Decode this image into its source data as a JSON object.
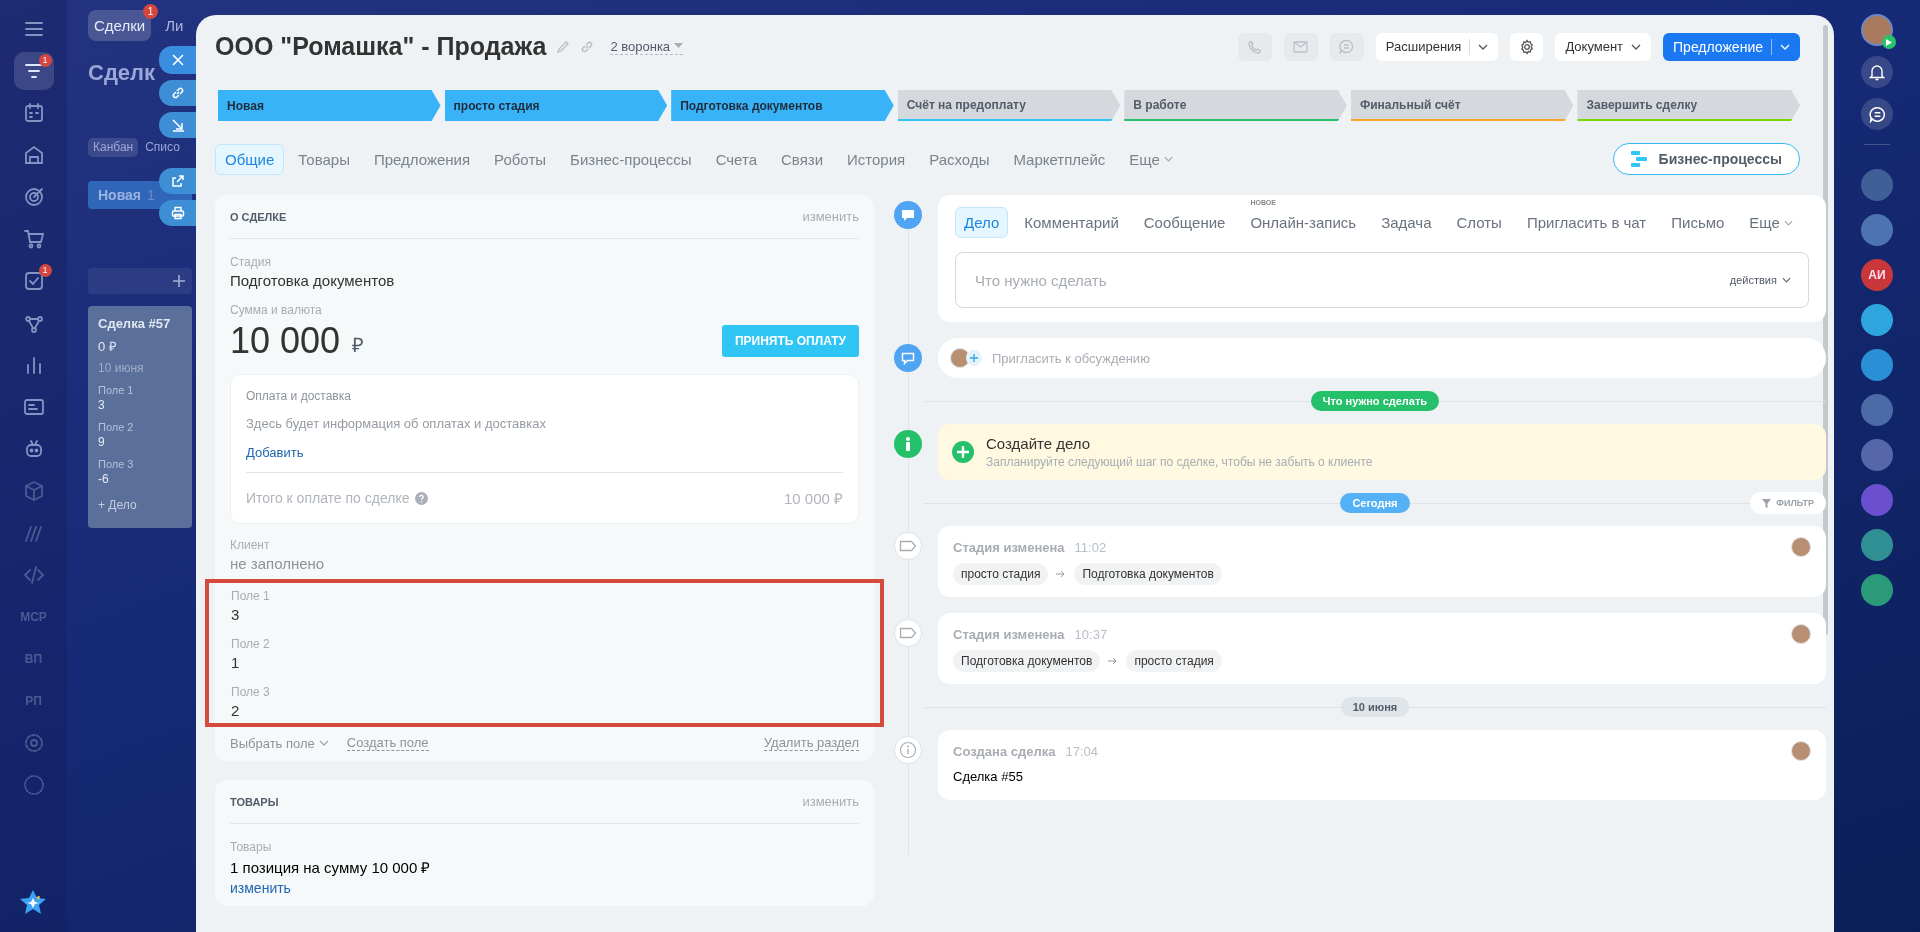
{
  "left_nav": [
    {
      "kind": "menu",
      "selected": false
    },
    {
      "kind": "funnel",
      "badge": "1",
      "selected": true
    },
    {
      "kind": "calendar",
      "selected": false
    },
    {
      "kind": "storage",
      "selected": false
    },
    {
      "kind": "target",
      "selected": false
    },
    {
      "kind": "cart",
      "selected": false
    },
    {
      "kind": "task",
      "badge": "1",
      "selected": false
    },
    {
      "kind": "flow",
      "selected": false
    },
    {
      "kind": "chart",
      "selected": false
    },
    {
      "kind": "card",
      "selected": false
    },
    {
      "kind": "robot",
      "selected": false
    },
    {
      "kind": "box",
      "selected": false
    },
    {
      "kind": "stripes",
      "selected": false
    },
    {
      "kind": "code",
      "selected": false
    },
    {
      "kind": "text",
      "label": "MCP",
      "selected": false
    },
    {
      "kind": "text",
      "label": "ВП",
      "selected": false
    },
    {
      "kind": "text",
      "label": "РП",
      "selected": false
    },
    {
      "kind": "gear",
      "selected": false
    },
    {
      "kind": "sphere",
      "selected": false
    }
  ],
  "background_page": {
    "tabs": [
      {
        "label": "Сделки",
        "badge": "1",
        "selected": true
      },
      {
        "label": "Ли",
        "selected": false
      }
    ],
    "title": "Сделк",
    "views": [
      {
        "label": "Канбан",
        "selected": true
      },
      {
        "label": "Списо",
        "selected": false
      }
    ],
    "column": {
      "name": "Новая",
      "count": "1"
    },
    "card": {
      "title": "Сделка #57",
      "amount": "0 ₽",
      "date": "10 июня",
      "fields": [
        {
          "label": "Поле 1",
          "value": "3"
        },
        {
          "label": "Поле 2",
          "value": "9"
        },
        {
          "label": "Поле 3",
          "value": "-6"
        }
      ],
      "add": "+ Дело"
    }
  },
  "window": {
    "title": "ООО \"Ромашка\" - Продажа",
    "funnel": "2 воронка",
    "actions": [
      {
        "kind": "extensions",
        "label": "Расширения"
      },
      {
        "kind": "document",
        "label": "Документ"
      },
      {
        "kind": "primary",
        "label": "Предложение"
      }
    ]
  },
  "stages": [
    {
      "label": "Новая",
      "reached": true,
      "color": "#39b3f7"
    },
    {
      "label": "просто стадия",
      "reached": true,
      "color": "#39b3f7"
    },
    {
      "label": "Подготовка документов",
      "reached": true,
      "color": "#39b3f7"
    },
    {
      "label": "Счёт на предоплату",
      "reached": false,
      "color": "#2fc6f6"
    },
    {
      "label": "В работе",
      "reached": false,
      "color": "#25c16a"
    },
    {
      "label": "Финальный счёт",
      "reached": false,
      "color": "#f5a623"
    },
    {
      "label": "Завершить сделку",
      "reached": false,
      "color": "#7bd500"
    }
  ],
  "tabs": [
    {
      "label": "Общие",
      "selected": true
    },
    {
      "label": "Товары",
      "selected": false
    },
    {
      "label": "Предложения",
      "selected": false
    },
    {
      "label": "Роботы",
      "selected": false
    },
    {
      "label": "Бизнес-процессы",
      "selected": false
    },
    {
      "label": "Счета",
      "selected": false
    },
    {
      "label": "Связи",
      "selected": false
    },
    {
      "label": "История",
      "selected": false
    },
    {
      "label": "Расходы",
      "selected": false
    },
    {
      "label": "Маркетплейс",
      "selected": false
    },
    {
      "label": "Еще",
      "selected": false
    }
  ],
  "bp_button": "Бизнес-процессы",
  "deal": {
    "heading": "О СДЕЛКЕ",
    "edit": "изменить",
    "stage_label": "Стадия",
    "stage": "Подготовка документов",
    "amount_label": "Сумма и валюта",
    "amount": "10 000",
    "currency": "₽",
    "pay_button": "ПРИНЯТЬ ОПЛАТУ",
    "payment": {
      "title": "Оплата и доставка",
      "info": "Здесь будет информация об оплатах и доставках",
      "add": "Добавить",
      "total_label": "Итого к оплате по сделке",
      "total": "10 000 ₽"
    },
    "client_label": "Клиент",
    "client": "не заполнено",
    "fields_highlighted": true,
    "fields": [
      {
        "label": "Поле 1",
        "value": "3"
      },
      {
        "label": "Поле 2",
        "value": "1"
      },
      {
        "label": "Поле 3",
        "value": "2"
      }
    ],
    "choose_field": "Выбрать поле",
    "create_field": "Создать поле",
    "delete_section": "Удалить раздел"
  },
  "products": {
    "heading": "ТОВАРЫ",
    "edit": "изменить",
    "label": "Товары",
    "value": "1 позиция на сумму 10 000 ₽",
    "link": "изменить"
  },
  "timeline": [
    {
      "kind": "composer",
      "tabs": [
        {
          "label": "Дело",
          "selected": true
        },
        {
          "label": "Комментарий",
          "selected": false
        },
        {
          "label": "Сообщение",
          "selected": false
        },
        {
          "label": "Онлайн-запись",
          "badge": "НОВОЕ",
          "selected": false
        },
        {
          "label": "Задача",
          "selected": false
        },
        {
          "label": "Слоты",
          "selected": false
        },
        {
          "label": "Пригласить в чат",
          "selected": false
        },
        {
          "label": "Письмо",
          "selected": false
        },
        {
          "label": "Еще",
          "selected": false
        }
      ],
      "placeholder": "Что нужно сделать",
      "actions": "действия"
    },
    {
      "kind": "comment",
      "placeholder": "Пригласить к обсуждению"
    },
    {
      "kind": "divider",
      "label": "Что нужно сделать",
      "color": "#25c16a"
    },
    {
      "kind": "create",
      "title": "Создайте дело",
      "text": "Запланируйте следующий шаг по сделке, чтобы не забыть о клиенте"
    },
    {
      "kind": "divider",
      "label": "Сегодня",
      "color": "#55b1f6",
      "filter": "ФИЛЬТР"
    },
    {
      "kind": "stage",
      "title": "Стадия изменена",
      "time": "11:02",
      "from": "просто стадия",
      "to": "Подготовка документов"
    },
    {
      "kind": "stage",
      "title": "Стадия изменена",
      "time": "10:37",
      "from": "Подготовка документов",
      "to": "просто стадия"
    },
    {
      "kind": "divider",
      "label": "10 июня",
      "color": "#dfe4e8"
    },
    {
      "kind": "created",
      "title": "Создана сделка",
      "time": "17:04",
      "body": "Сделка #55"
    }
  ],
  "right_rail": [
    {
      "color": "#3f5f96"
    },
    {
      "color": "#4d74b0"
    },
    {
      "color": "#c8383a",
      "label": "АИ"
    },
    {
      "color": "#2ea6dd"
    },
    {
      "color": "#2b8fd6"
    },
    {
      "color": "#4b6aa6"
    },
    {
      "color": "#5567a8"
    },
    {
      "color": "#6a4fcf"
    },
    {
      "color": "#2f8f92"
    },
    {
      "color": "#2a9a78"
    }
  ]
}
